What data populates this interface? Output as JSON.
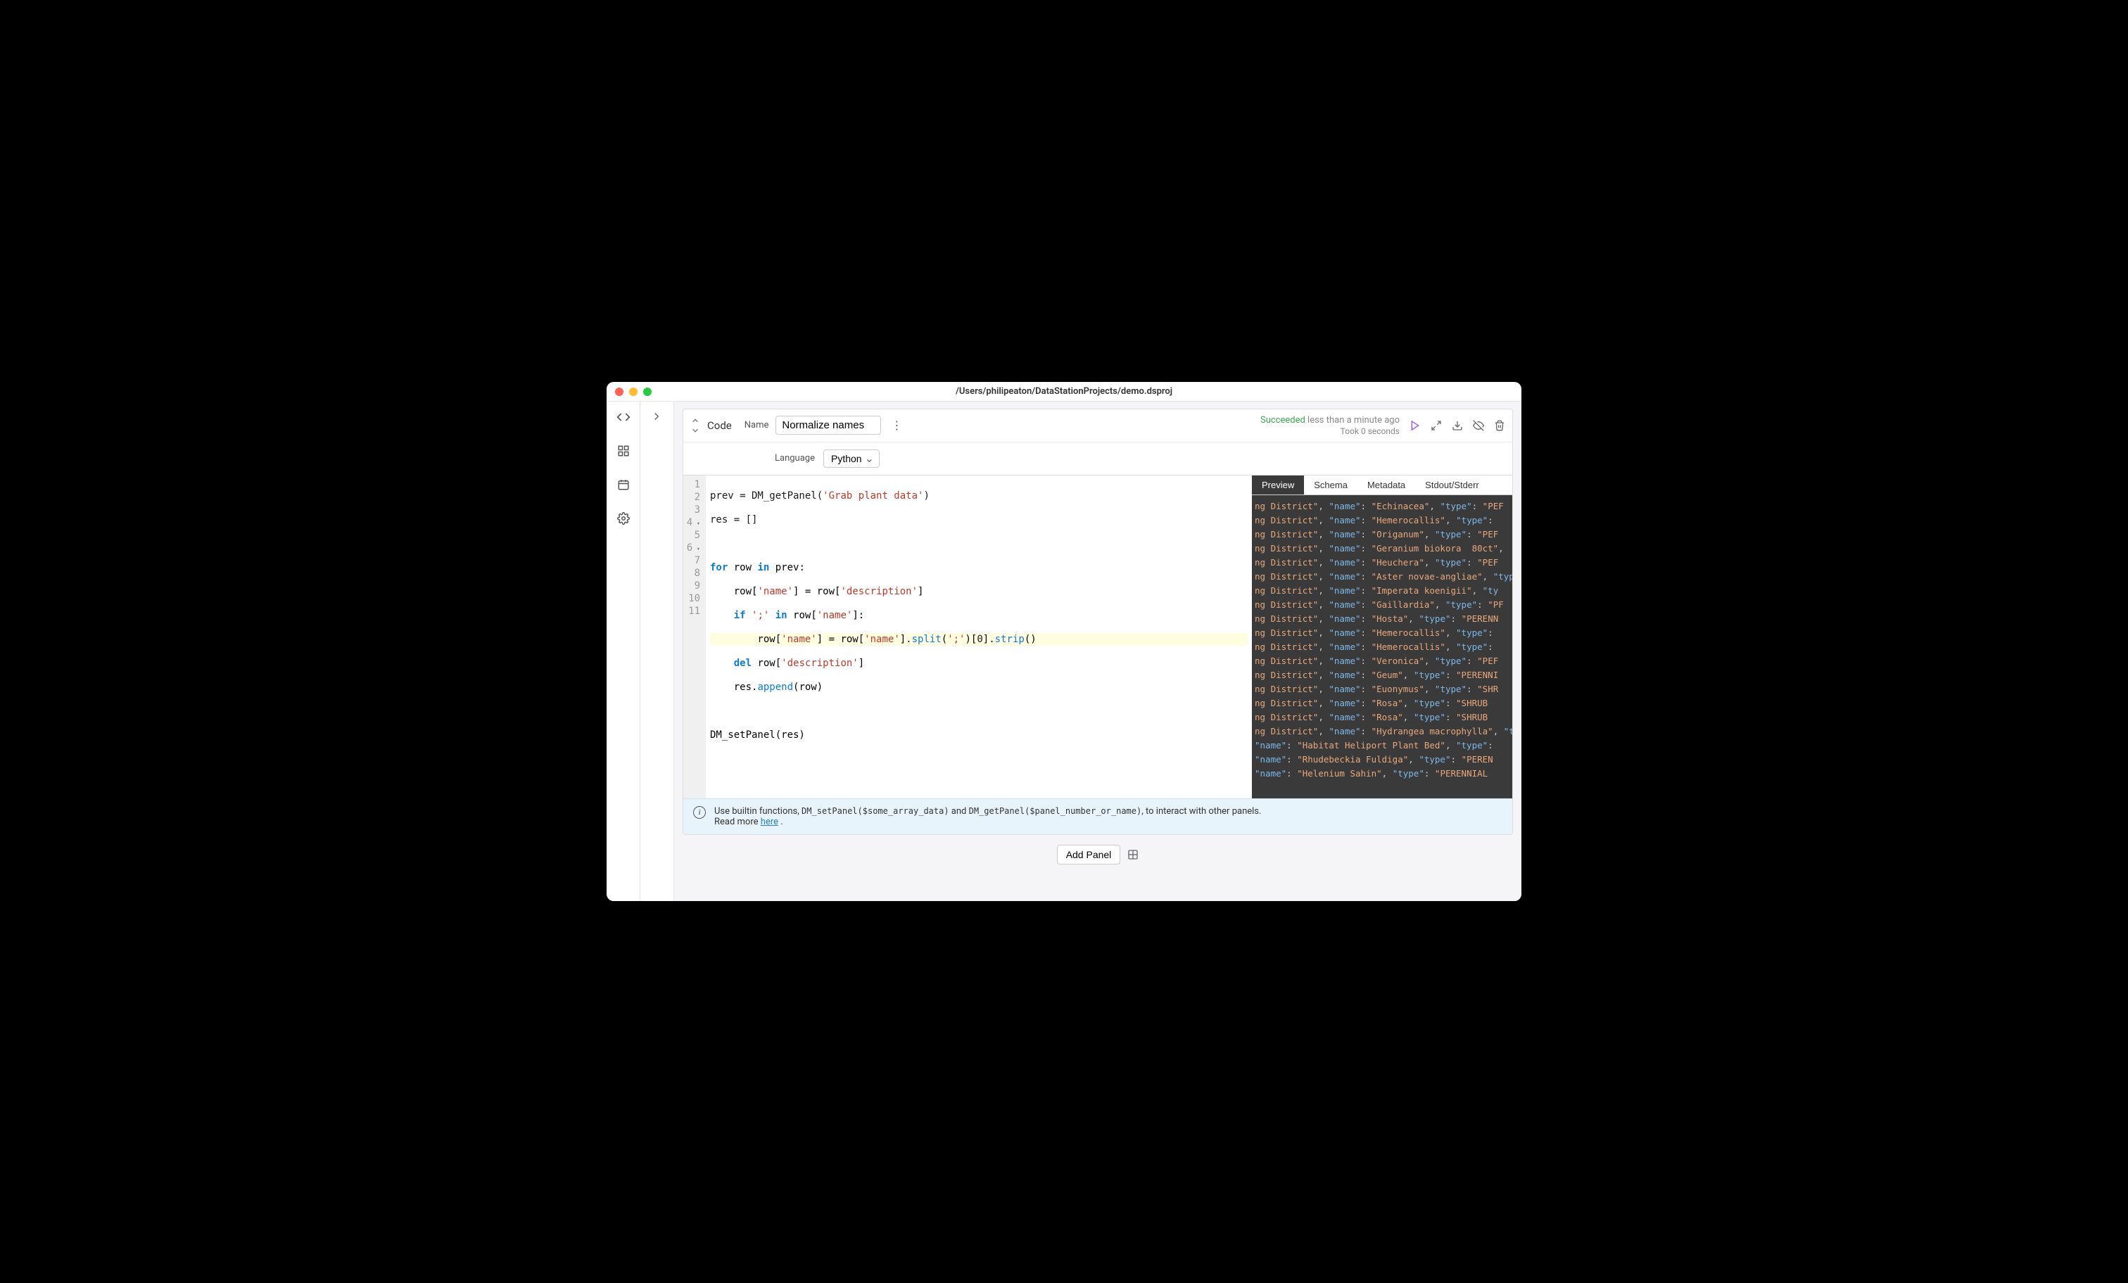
{
  "titlebar": {
    "path": "/Users/philipeaton/DataStationProjects/demo.dsproj"
  },
  "panel": {
    "type": "Code",
    "name_label": "Name",
    "name_value": "Normalize names",
    "status": {
      "succeeded": "Succeeded",
      "ago": "less than a minute ago",
      "took": "Took 0 seconds"
    },
    "language_label": "Language",
    "language_value": "Python"
  },
  "gutter": [
    "1",
    "2",
    "3",
    "4",
    "5",
    "6",
    "7",
    "8",
    "9",
    "10",
    "11"
  ],
  "code": {
    "l1_a": "prev = DM_getPanel(",
    "l1_s": "'Grab plant data'",
    "l1_b": ")",
    "l2": "res = []",
    "l3": "",
    "l4_a": "for",
    "l4_b": " row ",
    "l4_c": "in",
    "l4_d": " prev:",
    "l5_a": "    row[",
    "l5_s1": "'name'",
    "l5_b": "] = row[",
    "l5_s2": "'description'",
    "l5_c": "]",
    "l6_a": "    ",
    "l6_if": "if",
    "l6_b": " ",
    "l6_s": "';'",
    "l6_c": " ",
    "l6_in": "in",
    "l6_d": " row[",
    "l6_s2": "'name'",
    "l6_e": "]:",
    "l7_a": "        row[",
    "l7_s1": "'name'",
    "l7_b": "] = row[",
    "l7_s2": "'name'",
    "l7_c": "].",
    "l7_m1": "split",
    "l7_d": "(",
    "l7_s3": "';'",
    "l7_e": ")[",
    "l7_n": "0",
    "l7_f": "].",
    "l7_m2": "strip",
    "l7_g": "()",
    "l8_a": "    ",
    "l8_del": "del",
    "l8_b": " row[",
    "l8_s": "'description'",
    "l8_c": "]",
    "l9_a": "    res.",
    "l9_m": "append",
    "l9_b": "(row)",
    "l10": "",
    "l11": "DM_setPanel(res)"
  },
  "preview": {
    "tabs": [
      "Preview",
      "Schema",
      "Metadata",
      "Stdout/Stderr"
    ],
    "rows": [
      {
        "pre": "ng District",
        "name": "Echinacea",
        "type": "PEF"
      },
      {
        "pre": "ng District",
        "name": "Hemerocallis",
        "type": ""
      },
      {
        "pre": "ng District",
        "name": "Origanum",
        "type": "PEF"
      },
      {
        "pre": "ng District",
        "name": "Geranium biokora  80ct",
        "type": null
      },
      {
        "pre": "ng District",
        "name": "Heuchera",
        "type": "PEF"
      },
      {
        "pre": "ng District",
        "name": "Aster novae-angliae",
        "type": ""
      },
      {
        "pre": "ng District",
        "name": "Imperata koenigii",
        "type": null,
        "tyonly": true
      },
      {
        "pre": "ng District",
        "name": "Gaillardia",
        "type": "PF"
      },
      {
        "pre": "ng District",
        "name": "Hosta",
        "type": "PERENN"
      },
      {
        "pre": "ng District",
        "name": "Hemerocallis",
        "type": ""
      },
      {
        "pre": "ng District",
        "name": "Hemerocallis",
        "type": ""
      },
      {
        "pre": "ng District",
        "name": "Veronica",
        "type": "PEF"
      },
      {
        "pre": "ng District",
        "name": "Geum",
        "type": "PERENNI"
      },
      {
        "pre": "ng District",
        "name": "Euonymus",
        "type": "SHR"
      },
      {
        "pre": "ng District",
        "name": "Rosa",
        "type": "SHRUB"
      },
      {
        "pre": "ng District",
        "name": "Rosa",
        "type": "SHRUB"
      },
      {
        "pre": "ng District",
        "name": "Hydrangea macrophylla",
        "type": ""
      },
      {
        "pre": "",
        "name": "Habitat Heliport Plant Bed",
        "type": ""
      },
      {
        "pre": "",
        "name": "Rhudebeckia Fuldiga",
        "type": "PEREN"
      },
      {
        "pre": "",
        "name": "Helenium Sahin",
        "type": "PERENNIAL"
      }
    ]
  },
  "info": {
    "text1": "Use builtin functions, ",
    "code1": "DM_setPanel($some_array_data)",
    "text2": " and ",
    "code2": "DM_getPanel($panel_number_or_name)",
    "text3": ", to interact with other panels.",
    "readmore": "Read more ",
    "link": "here",
    "dot": " ."
  },
  "add_panel": "Add Panel"
}
